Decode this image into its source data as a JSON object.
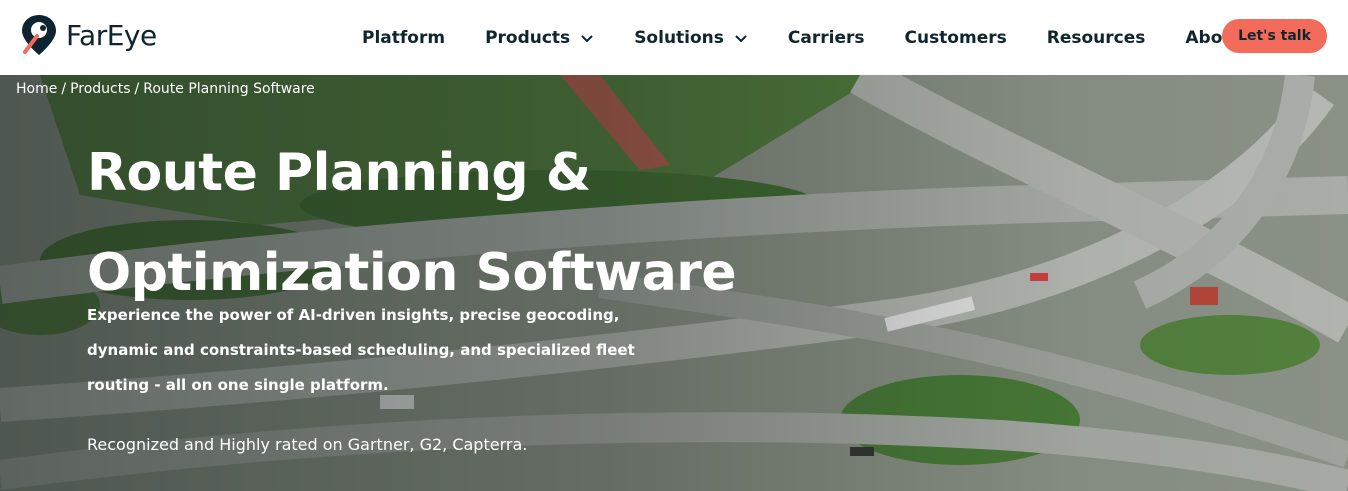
{
  "brand": {
    "name": "FarEye",
    "accent": "#f26b5b",
    "dark": "#10262f"
  },
  "nav": {
    "items": [
      {
        "label": "Platform",
        "has_dropdown": false
      },
      {
        "label": "Products",
        "has_dropdown": true
      },
      {
        "label": "Solutions",
        "has_dropdown": true
      },
      {
        "label": "Carriers",
        "has_dropdown": false
      },
      {
        "label": "Customers",
        "has_dropdown": false
      },
      {
        "label": "Resources",
        "has_dropdown": false
      },
      {
        "label": "About",
        "has_dropdown": true
      }
    ],
    "cta_label": "Let's talk"
  },
  "breadcrumb": {
    "items": [
      "Home",
      "Products",
      "Route Planning Software"
    ],
    "separator": "/"
  },
  "hero": {
    "title_line1": "Route Planning &",
    "title_line2": "Optimization Software",
    "description": "Experience the power of AI-driven insights, precise geocoding, dynamic and constraints-based scheduling, and specialized fleet routing - all on one single platform.",
    "note": "Recognized and Highly rated on Gartner, G2, Capterra."
  }
}
